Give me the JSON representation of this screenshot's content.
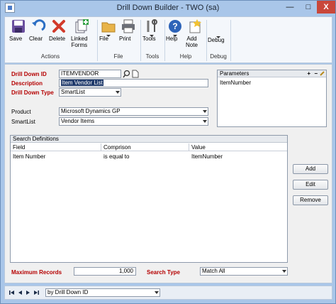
{
  "window": {
    "title": "Drill Down Builder  -  TWO (sa)",
    "minimize_glyph": "—",
    "maximize_glyph": "□",
    "close_glyph": "X"
  },
  "ribbon": {
    "items": [
      {
        "label": "Save",
        "icon": "save-icon"
      },
      {
        "label": "Clear",
        "icon": "clear-icon"
      },
      {
        "label": "Delete",
        "icon": "delete-icon"
      },
      {
        "label": "Linked\nForms",
        "icon": "linked-forms-icon"
      },
      {
        "label": "File",
        "icon": "file-icon"
      },
      {
        "label": "Print",
        "icon": "print-icon"
      },
      {
        "label": "Tools",
        "icon": "tools-icon"
      },
      {
        "label": "Help",
        "icon": "help-icon"
      },
      {
        "label": "Add\nNote",
        "icon": "add-note-icon"
      },
      {
        "label": "Debug",
        "icon": "debug-icon"
      }
    ],
    "groups": [
      "Actions",
      "File",
      "Tools",
      "Help",
      "Debug"
    ]
  },
  "form": {
    "drill_down_id_label": "Drill Down ID",
    "drill_down_id_value": "ITEMVENDOR",
    "description_label": "Description",
    "description_value": "Item Vendor List",
    "drill_down_type_label": "Drill Down Type",
    "drill_down_type_value": "SmartList",
    "product_label": "Product",
    "product_value": "Microsoft Dynamics GP",
    "smartlist_label": "SmartList",
    "smartlist_value": "Vendor Items",
    "maximum_records_label": "Maximum Records",
    "maximum_records_value": "1,000",
    "search_type_label": "Search Type",
    "search_type_value": "Match All"
  },
  "parameters": {
    "title": "Parameters",
    "add_glyph": "+",
    "remove_glyph": "−",
    "items": [
      "ItemNumber"
    ]
  },
  "search_definitions": {
    "title": "Search Definitions",
    "columns": [
      "Field",
      "Comprison",
      "Value"
    ],
    "rows": [
      {
        "field": "Item Number",
        "comparison": "is equal to",
        "value": "ItemNumber"
      }
    ]
  },
  "buttons": {
    "add": "Add",
    "edit": "Edit",
    "remove": "Remove"
  },
  "navigation": {
    "sort_by_value": "by Drill Down ID"
  },
  "colors": {
    "required_label": "#b50000",
    "window_frame": "#a9c6e9",
    "close_button": "#c9473a"
  }
}
